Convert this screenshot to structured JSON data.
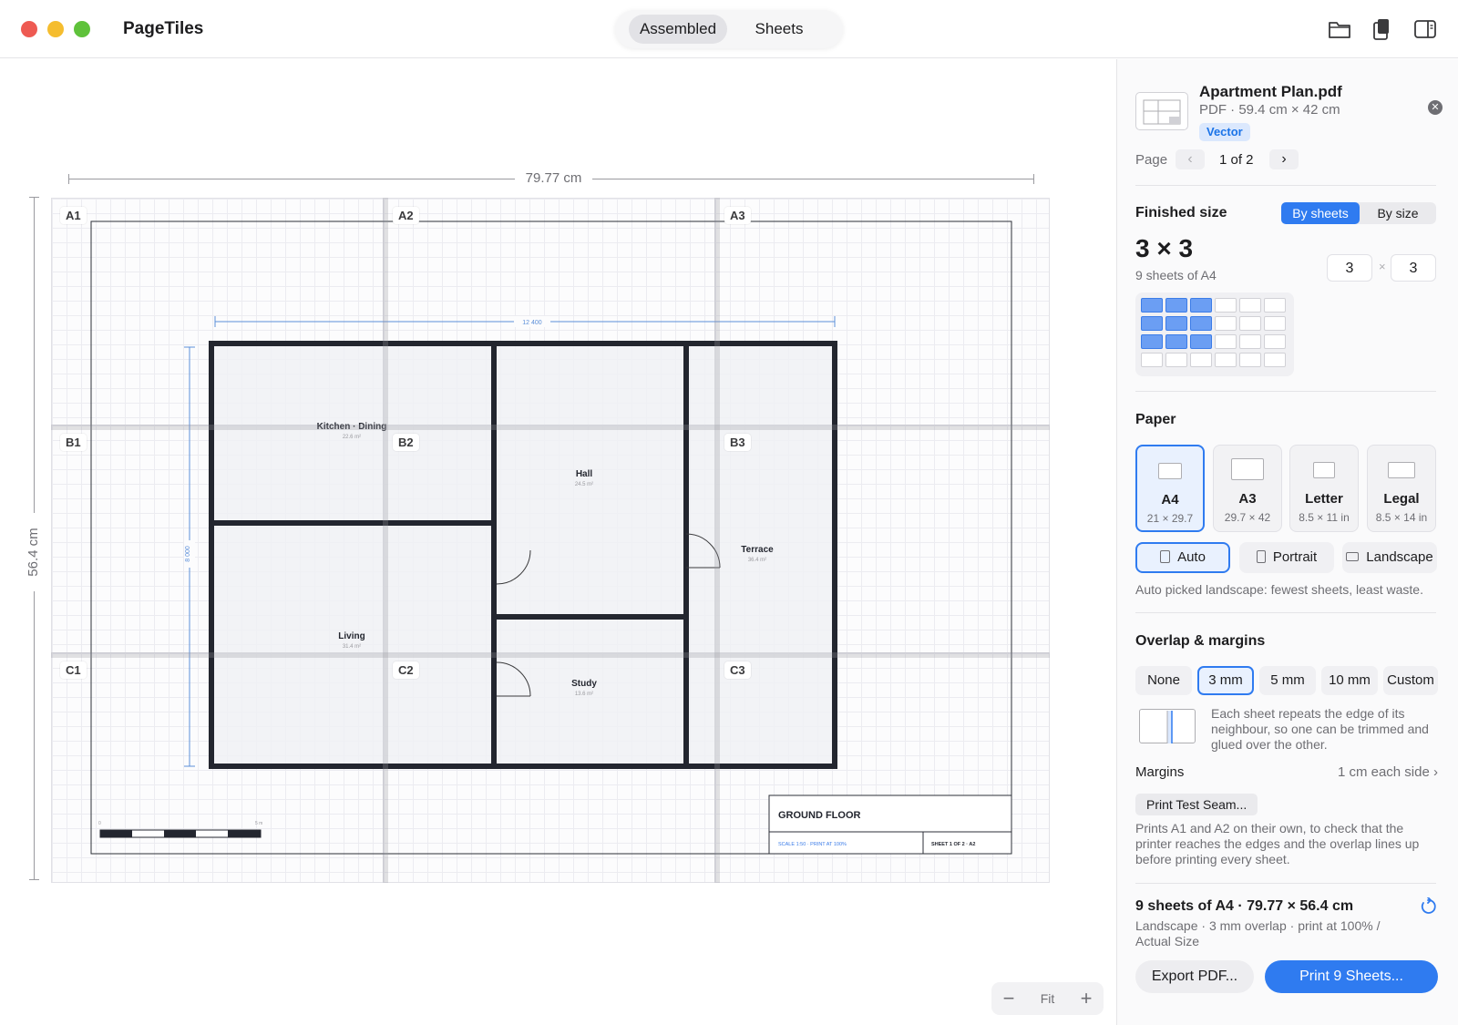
{
  "app": {
    "title": "PageTiles"
  },
  "toolbar": {
    "view_tabs": [
      "Assembled",
      "Sheets"
    ],
    "active_tab": "Assembled",
    "icons": [
      "folder-icon",
      "page-sizes-icon",
      "sidebar-toggle-icon"
    ]
  },
  "canvas": {
    "width_label": "79.77 cm",
    "height_label": "56.4 cm",
    "sheet_labels": [
      "A1",
      "A2",
      "A3",
      "B1",
      "B2",
      "B3",
      "C1",
      "C2",
      "C3"
    ],
    "rooms": [
      {
        "name": "Kitchen · Dining",
        "area": "22.6 m²"
      },
      {
        "name": "Hall",
        "area": "24.5 m²"
      },
      {
        "name": "Terrace",
        "area": "36.4 m²"
      },
      {
        "name": "Living",
        "area": "31.4 m²"
      },
      {
        "name": "Study",
        "area": "13.6 m²"
      }
    ],
    "plan_dim_width": "12 400",
    "plan_dim_height": "8 000",
    "scale_bar_start": "0",
    "scale_bar_end": "5 m",
    "title_block": {
      "title": "GROUND FLOOR",
      "scale": "SCALE 1:50 · PRINT AT 100%",
      "sheet": "SHEET 1 OF 2 · A2"
    }
  },
  "zoom": {
    "minus": "−",
    "fit": "Fit",
    "plus": "+"
  },
  "file": {
    "name": "Apartment Plan.pdf",
    "meta": "PDF · 59.4 cm × 42 cm",
    "badge": "Vector",
    "page_label": "Page",
    "page_value": "1 of 2"
  },
  "finished_size": {
    "title": "Finished size",
    "mode_options": [
      "By sheets",
      "By size"
    ],
    "mode_selected": "By sheets",
    "grid_label": "3 × 3",
    "sheets_label": "9 sheets of A4",
    "cols": "3",
    "rows": "3",
    "times": "×",
    "preview_cols": 6,
    "preview_rows": 4,
    "selected_cols": 3,
    "selected_rows": 3
  },
  "paper": {
    "title": "Paper",
    "options": [
      {
        "name": "A4",
        "dims": "21 × 29.7"
      },
      {
        "name": "A3",
        "dims": "29.7 × 42"
      },
      {
        "name": "Letter",
        "dims": "8.5 × 11 in"
      },
      {
        "name": "Legal",
        "dims": "8.5 × 14 in"
      }
    ],
    "selected": "A4",
    "orientation_options": [
      "Auto",
      "Portrait",
      "Landscape"
    ],
    "orientation_selected": "Auto",
    "note": "Auto picked landscape: fewest sheets, least waste."
  },
  "overlap": {
    "title": "Overlap & margins",
    "options": [
      "None",
      "3 mm",
      "5 mm",
      "10 mm",
      "Custom"
    ],
    "selected": "3 mm",
    "note": "Each sheet repeats the edge of its neighbour, so one can be trimmed and glued over the other.",
    "margins_label": "Margins",
    "margins_value": "1 cm each side",
    "margins_chevron": "›",
    "test_button": "Print Test Seam...",
    "test_note": "Prints A1 and A2 on their own, to check that the printer reaches the edges and the overlap lines up before printing every sheet."
  },
  "summary": {
    "title": "9 sheets of A4 · 79.77 × 56.4 cm",
    "subtitle": "Landscape · 3 mm overlap · print at 100% / Actual Size",
    "export_label": "Export PDF...",
    "print_label": "Print 9 Sheets..."
  },
  "colors": {
    "accent": "#2f7bf0",
    "wall": "#23262f",
    "dimension": "#5b8fd9"
  }
}
